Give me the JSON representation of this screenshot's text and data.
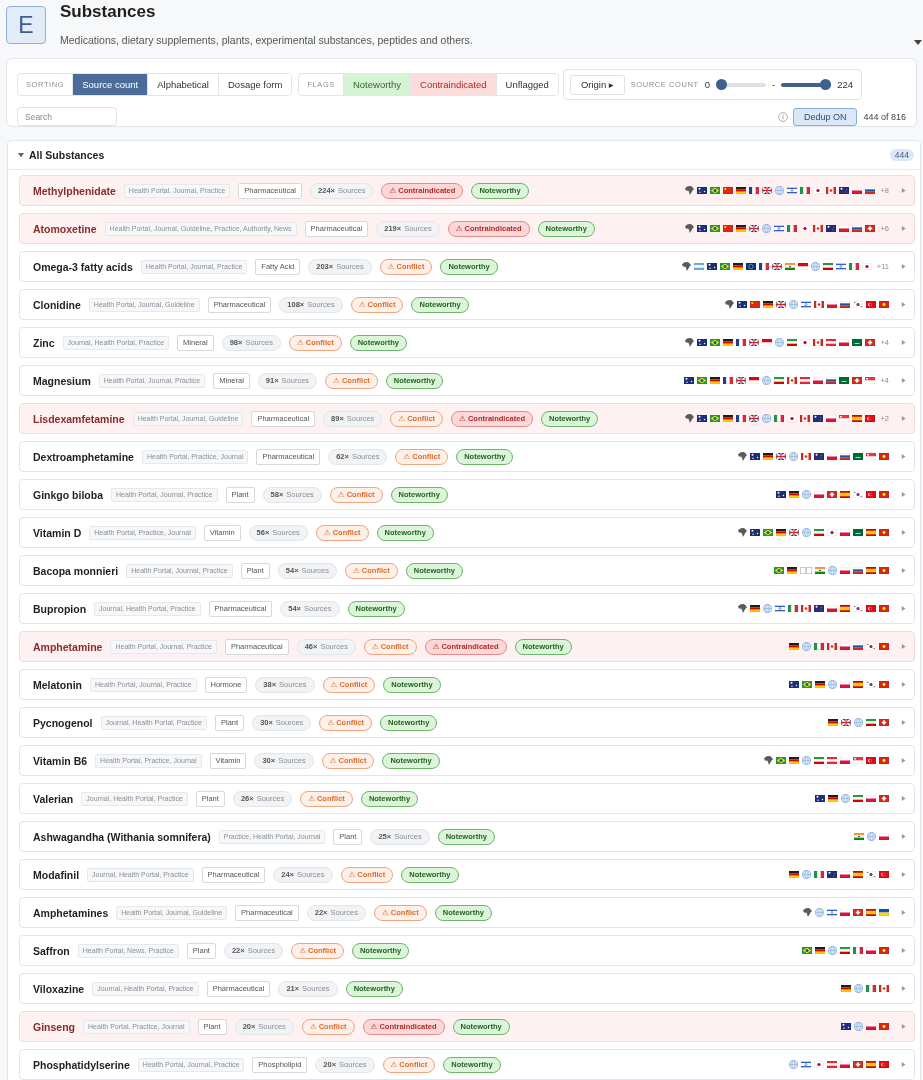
{
  "header": {
    "logo": "E",
    "title": "Substances",
    "subtitle": "Medications, dietary supplements, plants, experimental substances, peptides and others."
  },
  "toolbar": {
    "sorting": {
      "label": "SORTING",
      "options": [
        {
          "label": "Source count",
          "selected": true
        },
        {
          "label": "Alphabetical",
          "selected": false
        },
        {
          "label": "Dosage form",
          "selected": false
        }
      ]
    },
    "flags": {
      "label": "FLAGS",
      "options": [
        {
          "label": "Noteworthy",
          "kind": "noteworthy"
        },
        {
          "label": "Contraindicated",
          "kind": "contraindicated"
        },
        {
          "label": "Unflagged",
          "kind": "unflagged"
        }
      ]
    },
    "origin_button": "Origin ▸",
    "source_count": {
      "label": "SOURCE COUNT",
      "min_reading": "0",
      "min_slider": {
        "level": 0
      },
      "separator": "-",
      "max_slider": {
        "level": 1
      },
      "max_reading": "224"
    },
    "search": {
      "placeholder": "Search"
    },
    "dedup": {
      "label": "Dedup ON",
      "on": true
    },
    "result_count": "444 of 816"
  },
  "section": {
    "title": "All Substances",
    "expanded": true,
    "count": "444",
    "rows": [
      {
        "name": "Methylphenidate",
        "source_types": "Health Portal, Journal, Practice",
        "form": "Pharmaceutical",
        "sources": "**224×** Sources",
        "badges": [
          {
            "kind": "contraindicated",
            "label": "⚠ Contraindicated"
          },
          {
            "kind": "noteworthy",
            "label": "Noteworthy"
          }
        ],
        "origins": [
          {
            "kind": "africa"
          },
          {
            "kind": "au"
          },
          {
            "kind": "br"
          },
          {
            "kind": "cn"
          },
          {
            "kind": "de"
          },
          {
            "kind": "fr"
          },
          {
            "kind": "gb"
          },
          {
            "kind": "globe"
          },
          {
            "kind": "il"
          },
          {
            "kind": "it"
          },
          {
            "kind": "jp"
          },
          {
            "kind": "ca"
          },
          {
            "kind": "nz"
          },
          {
            "kind": "pl"
          },
          {
            "kind": "ru"
          }
        ],
        "more": "+8",
        "expanded": false
      },
      {
        "name": "Atomoxetine",
        "source_types": "Health Portal, Journal, Guideline, Practice, Authority, News",
        "form": "Pharmaceutical",
        "sources": "**219×** Sources",
        "badges": [
          {
            "kind": "contraindicated",
            "label": "⚠ Contraindicated"
          },
          {
            "kind": "noteworthy",
            "label": "Noteworthy"
          }
        ],
        "origins": [
          {
            "kind": "africa"
          },
          {
            "kind": "au"
          },
          {
            "kind": "br"
          },
          {
            "kind": "cn"
          },
          {
            "kind": "de"
          },
          {
            "kind": "gb"
          },
          {
            "kind": "globe"
          },
          {
            "kind": "il"
          },
          {
            "kind": "it"
          },
          {
            "kind": "jp"
          },
          {
            "kind": "ca"
          },
          {
            "kind": "nz"
          },
          {
            "kind": "pl"
          },
          {
            "kind": "ru"
          },
          {
            "kind": "ch"
          }
        ],
        "more": "+6",
        "expanded": false
      },
      {
        "name": "Omega-3 fatty acids",
        "source_types": "Health Portal, Journal, Practice",
        "form": "Fatty Acid",
        "sources": "**203×** Sources",
        "badges": [
          {
            "kind": "conflict",
            "label": "⚠ Conflict"
          },
          {
            "kind": "noteworthy",
            "label": "Noteworthy"
          }
        ],
        "origins": [
          {
            "kind": "africa"
          },
          {
            "kind": "ar"
          },
          {
            "kind": "au"
          },
          {
            "kind": "br"
          },
          {
            "kind": "de"
          },
          {
            "kind": "eu"
          },
          {
            "kind": "fr"
          },
          {
            "kind": "gb"
          },
          {
            "kind": "in"
          },
          {
            "kind": "id"
          },
          {
            "kind": "globe"
          },
          {
            "kind": "ir"
          },
          {
            "kind": "il"
          },
          {
            "kind": "it"
          },
          {
            "kind": "jp"
          }
        ],
        "more": "+11",
        "expanded": false
      },
      {
        "name": "Clonidine",
        "source_types": "Health Portal, Journal, Guideline",
        "form": "Pharmaceutical",
        "sources": "**108×** Sources",
        "badges": [
          {
            "kind": "conflict",
            "label": "⚠ Conflict"
          },
          {
            "kind": "noteworthy",
            "label": "Noteworthy"
          }
        ],
        "origins": [
          {
            "kind": "africa"
          },
          {
            "kind": "au"
          },
          {
            "kind": "cn"
          },
          {
            "kind": "de"
          },
          {
            "kind": "gb"
          },
          {
            "kind": "globe"
          },
          {
            "kind": "il"
          },
          {
            "kind": "ca"
          },
          {
            "kind": "pl"
          },
          {
            "kind": "ru"
          },
          {
            "kind": "kr"
          },
          {
            "kind": "tr"
          },
          {
            "kind": "vn"
          }
        ],
        "expanded": false
      },
      {
        "name": "Zinc",
        "source_types": "Journal, Health Portal, Practice",
        "form": "Mineral",
        "sources": "**98×** Sources",
        "badges": [
          {
            "kind": "conflict",
            "label": "⚠ Conflict"
          },
          {
            "kind": "noteworthy",
            "label": "Noteworthy"
          }
        ],
        "origins": [
          {
            "kind": "africa"
          },
          {
            "kind": "au"
          },
          {
            "kind": "br"
          },
          {
            "kind": "de"
          },
          {
            "kind": "fr"
          },
          {
            "kind": "gb"
          },
          {
            "kind": "id"
          },
          {
            "kind": "globe"
          },
          {
            "kind": "ir"
          },
          {
            "kind": "jp"
          },
          {
            "kind": "ca"
          },
          {
            "kind": "at"
          },
          {
            "kind": "pl"
          },
          {
            "kind": "sa"
          },
          {
            "kind": "ch"
          }
        ],
        "more": "+4",
        "expanded": false
      },
      {
        "name": "Magnesium",
        "source_types": "Health Portal, Journal, Practice",
        "form": "Mineral",
        "sources": "**91×** Sources",
        "badges": [
          {
            "kind": "conflict",
            "label": "⚠ Conflict"
          },
          {
            "kind": "noteworthy",
            "label": "Noteworthy"
          }
        ],
        "origins": [
          {
            "kind": "au"
          },
          {
            "kind": "br"
          },
          {
            "kind": "de"
          },
          {
            "kind": "fr"
          },
          {
            "kind": "gb"
          },
          {
            "kind": "id"
          },
          {
            "kind": "globe"
          },
          {
            "kind": "ir"
          },
          {
            "kind": "ca"
          },
          {
            "kind": "at"
          },
          {
            "kind": "pl"
          },
          {
            "kind": "ru"
          },
          {
            "kind": "sa"
          },
          {
            "kind": "ch"
          },
          {
            "kind": "sg"
          }
        ],
        "more": "+4",
        "expanded": false
      },
      {
        "name": "Lisdexamfetamine",
        "source_types": "Health Portal, Journal, Guideline",
        "form": "Pharmaceutical",
        "sources": "**89×** Sources",
        "badges": [
          {
            "kind": "conflict",
            "label": "⚠ Conflict"
          },
          {
            "kind": "contraindicated",
            "label": "⚠ Contraindicated"
          },
          {
            "kind": "noteworthy",
            "label": "Noteworthy"
          }
        ],
        "origins": [
          {
            "kind": "africa"
          },
          {
            "kind": "au"
          },
          {
            "kind": "br"
          },
          {
            "kind": "de"
          },
          {
            "kind": "fr"
          },
          {
            "kind": "gb"
          },
          {
            "kind": "globe"
          },
          {
            "kind": "it"
          },
          {
            "kind": "jp"
          },
          {
            "kind": "ca"
          },
          {
            "kind": "nz"
          },
          {
            "kind": "pl"
          },
          {
            "kind": "sg"
          },
          {
            "kind": "es"
          },
          {
            "kind": "tr"
          }
        ],
        "more": "+2",
        "expanded": false
      },
      {
        "name": "Dextroamphetamine",
        "source_types": "Health Portal, Practice, Journal",
        "form": "Pharmaceutical",
        "sources": "**62×** Sources",
        "badges": [
          {
            "kind": "conflict",
            "label": "⚠ Conflict"
          },
          {
            "kind": "noteworthy",
            "label": "Noteworthy"
          }
        ],
        "origins": [
          {
            "kind": "africa"
          },
          {
            "kind": "au"
          },
          {
            "kind": "de"
          },
          {
            "kind": "gb"
          },
          {
            "kind": "globe"
          },
          {
            "kind": "ca"
          },
          {
            "kind": "nz"
          },
          {
            "kind": "pl"
          },
          {
            "kind": "ru"
          },
          {
            "kind": "sa"
          },
          {
            "kind": "sg"
          },
          {
            "kind": "vn"
          }
        ],
        "expanded": false
      },
      {
        "name": "Ginkgo biloba",
        "source_types": "Health Portal, Journal, Practice",
        "form": "Plant",
        "sources": "**58×** Sources",
        "badges": [
          {
            "kind": "conflict",
            "label": "⚠ Conflict"
          },
          {
            "kind": "noteworthy",
            "label": "Noteworthy"
          }
        ],
        "origins": [
          {
            "kind": "au"
          },
          {
            "kind": "de"
          },
          {
            "kind": "globe"
          },
          {
            "kind": "pl"
          },
          {
            "kind": "ch"
          },
          {
            "kind": "es"
          },
          {
            "kind": "kr"
          },
          {
            "kind": "tr"
          },
          {
            "kind": "vn"
          }
        ],
        "expanded": false
      },
      {
        "name": "Vitamin D",
        "source_types": "Health Portal, Practice, Journal",
        "form": "Vitamin",
        "sources": "**56×** Sources",
        "badges": [
          {
            "kind": "conflict",
            "label": "⚠ Conflict"
          },
          {
            "kind": "noteworthy",
            "label": "Noteworthy"
          }
        ],
        "origins": [
          {
            "kind": "africa"
          },
          {
            "kind": "au"
          },
          {
            "kind": "br"
          },
          {
            "kind": "de"
          },
          {
            "kind": "gb"
          },
          {
            "kind": "globe"
          },
          {
            "kind": "ir"
          },
          {
            "kind": "jp"
          },
          {
            "kind": "pl"
          },
          {
            "kind": "sa"
          },
          {
            "kind": "es"
          },
          {
            "kind": "vn"
          }
        ],
        "expanded": false
      },
      {
        "name": "Bacopa monnieri",
        "source_types": "Health Portal, Journal, Practice",
        "form": "Plant",
        "sources": "**54×** Sources",
        "badges": [
          {
            "kind": "conflict",
            "label": "⚠ Conflict"
          },
          {
            "kind": "noteworthy",
            "label": "Noteworthy"
          }
        ],
        "origins": [
          {
            "kind": "br"
          },
          {
            "kind": "de"
          },
          {
            "kind": "unknown"
          },
          {
            "kind": "in"
          },
          {
            "kind": "globe"
          },
          {
            "kind": "pl"
          },
          {
            "kind": "ru"
          },
          {
            "kind": "es"
          },
          {
            "kind": "vn"
          }
        ],
        "expanded": false
      },
      {
        "name": "Bupropion",
        "source_types": "Journal, Health Portal, Practice",
        "form": "Pharmaceutical",
        "sources": "**54×** Sources",
        "badges": [
          {
            "kind": "noteworthy",
            "label": "Noteworthy"
          }
        ],
        "origins": [
          {
            "kind": "africa"
          },
          {
            "kind": "de"
          },
          {
            "kind": "globe"
          },
          {
            "kind": "il"
          },
          {
            "kind": "it"
          },
          {
            "kind": "ca"
          },
          {
            "kind": "nz"
          },
          {
            "kind": "pl"
          },
          {
            "kind": "es"
          },
          {
            "kind": "kr"
          },
          {
            "kind": "tr"
          },
          {
            "kind": "vn"
          }
        ],
        "expanded": false
      },
      {
        "name": "Amphetamine",
        "source_types": "Health Portal, Journal, Practice",
        "form": "Pharmaceutical",
        "sources": "**46×** Sources",
        "badges": [
          {
            "kind": "conflict",
            "label": "⚠ Conflict"
          },
          {
            "kind": "contraindicated",
            "label": "⚠ Contraindicated"
          },
          {
            "kind": "noteworthy",
            "label": "Noteworthy"
          }
        ],
        "origins": [
          {
            "kind": "de"
          },
          {
            "kind": "globe"
          },
          {
            "kind": "it"
          },
          {
            "kind": "ca"
          },
          {
            "kind": "pl"
          },
          {
            "kind": "ru"
          },
          {
            "kind": "kr"
          },
          {
            "kind": "vn"
          }
        ],
        "expanded": false
      },
      {
        "name": "Melatonin",
        "source_types": "Health Portal, Journal, Practice",
        "form": "Hormone",
        "sources": "**38×** Sources",
        "badges": [
          {
            "kind": "conflict",
            "label": "⚠ Conflict"
          },
          {
            "kind": "noteworthy",
            "label": "Noteworthy"
          }
        ],
        "origins": [
          {
            "kind": "au"
          },
          {
            "kind": "br"
          },
          {
            "kind": "de"
          },
          {
            "kind": "globe"
          },
          {
            "kind": "pl"
          },
          {
            "kind": "es"
          },
          {
            "kind": "kr"
          },
          {
            "kind": "vn"
          }
        ],
        "expanded": false
      },
      {
        "name": "Pycnogenol",
        "source_types": "Journal, Health Portal, Practice",
        "form": "Plant",
        "sources": "**30×** Sources",
        "badges": [
          {
            "kind": "conflict",
            "label": "⚠ Conflict"
          },
          {
            "kind": "noteworthy",
            "label": "Noteworthy"
          }
        ],
        "origins": [
          {
            "kind": "de"
          },
          {
            "kind": "gb"
          },
          {
            "kind": "globe"
          },
          {
            "kind": "ir"
          },
          {
            "kind": "ch"
          }
        ],
        "expanded": false
      },
      {
        "name": "Vitamin B6",
        "source_types": "Health Portal, Practice, Journal",
        "form": "Vitamin",
        "sources": "**30×** Sources",
        "badges": [
          {
            "kind": "conflict",
            "label": "⚠ Conflict"
          },
          {
            "kind": "noteworthy",
            "label": "Noteworthy"
          }
        ],
        "origins": [
          {
            "kind": "africa"
          },
          {
            "kind": "br"
          },
          {
            "kind": "de"
          },
          {
            "kind": "globe"
          },
          {
            "kind": "ir"
          },
          {
            "kind": "at"
          },
          {
            "kind": "pl"
          },
          {
            "kind": "sg"
          },
          {
            "kind": "tr"
          },
          {
            "kind": "vn"
          }
        ],
        "expanded": false
      },
      {
        "name": "Valerian",
        "source_types": "Journal, Health Portal, Practice",
        "form": "Plant",
        "sources": "**26×** Sources",
        "badges": [
          {
            "kind": "conflict",
            "label": "⚠ Conflict"
          },
          {
            "kind": "noteworthy",
            "label": "Noteworthy"
          }
        ],
        "origins": [
          {
            "kind": "au"
          },
          {
            "kind": "de"
          },
          {
            "kind": "globe"
          },
          {
            "kind": "ir"
          },
          {
            "kind": "pl"
          },
          {
            "kind": "ch"
          }
        ],
        "expanded": false
      },
      {
        "name": "Ashwagandha (Withania somnifera)",
        "source_types": "Practice, Health Portal, Journal",
        "form": "Plant",
        "sources": "**25×** Sources",
        "badges": [
          {
            "kind": "noteworthy",
            "label": "Noteworthy"
          }
        ],
        "origins": [
          {
            "kind": "in"
          },
          {
            "kind": "globe"
          },
          {
            "kind": "pl"
          }
        ],
        "expanded": false
      },
      {
        "name": "Modafinil",
        "source_types": "Journal, Health Portal, Practice",
        "form": "Pharmaceutical",
        "sources": "**24×** Sources",
        "badges": [
          {
            "kind": "conflict",
            "label": "⚠ Conflict"
          },
          {
            "kind": "noteworthy",
            "label": "Noteworthy"
          }
        ],
        "origins": [
          {
            "kind": "de"
          },
          {
            "kind": "globe"
          },
          {
            "kind": "it"
          },
          {
            "kind": "nz"
          },
          {
            "kind": "pl"
          },
          {
            "kind": "es"
          },
          {
            "kind": "kr"
          },
          {
            "kind": "tr"
          }
        ],
        "expanded": false
      },
      {
        "name": "Amphetamines",
        "source_types": "Health Portal, Journal, Guideline",
        "form": "Pharmaceutical",
        "sources": "**22×** Sources",
        "badges": [
          {
            "kind": "conflict",
            "label": "⚠ Conflict"
          },
          {
            "kind": "noteworthy",
            "label": "Noteworthy"
          }
        ],
        "origins": [
          {
            "kind": "africa"
          },
          {
            "kind": "globe"
          },
          {
            "kind": "il"
          },
          {
            "kind": "pl"
          },
          {
            "kind": "ch"
          },
          {
            "kind": "es"
          },
          {
            "kind": "ua"
          }
        ],
        "expanded": false
      },
      {
        "name": "Saffron",
        "source_types": "Health Portal, News, Practice",
        "form": "Plant",
        "sources": "**22×** Sources",
        "badges": [
          {
            "kind": "conflict",
            "label": "⚠ Conflict"
          },
          {
            "kind": "noteworthy",
            "label": "Noteworthy"
          }
        ],
        "origins": [
          {
            "kind": "br"
          },
          {
            "kind": "de"
          },
          {
            "kind": "globe"
          },
          {
            "kind": "ir"
          },
          {
            "kind": "it"
          },
          {
            "kind": "pl"
          },
          {
            "kind": "vn"
          }
        ],
        "expanded": false
      },
      {
        "name": "Viloxazine",
        "source_types": "Journal, Health Portal, Practice",
        "form": "Pharmaceutical",
        "sources": "**21×** Sources",
        "badges": [
          {
            "kind": "noteworthy",
            "label": "Noteworthy"
          }
        ],
        "origins": [
          {
            "kind": "de"
          },
          {
            "kind": "globe"
          },
          {
            "kind": "it"
          },
          {
            "kind": "ca"
          }
        ],
        "expanded": false
      },
      {
        "name": "Ginseng",
        "source_types": "Health Portal, Practice, Journal",
        "form": "Plant",
        "sources": "**20×** Sources",
        "badges": [
          {
            "kind": "conflict",
            "label": "⚠ Conflict"
          },
          {
            "kind": "contraindicated",
            "label": "⚠ Contraindicated"
          },
          {
            "kind": "noteworthy",
            "label": "Noteworthy"
          }
        ],
        "origins": [
          {
            "kind": "au"
          },
          {
            "kind": "globe"
          },
          {
            "kind": "pl"
          },
          {
            "kind": "vn"
          }
        ],
        "expanded": false
      },
      {
        "name": "Phosphatidylserine",
        "source_types": "Health Portal, Journal, Practice",
        "form": "Phospholipid",
        "sources": "**20×** Sources",
        "badges": [
          {
            "kind": "conflict",
            "label": "⚠ Conflict"
          },
          {
            "kind": "noteworthy",
            "label": "Noteworthy"
          }
        ],
        "origins": [
          {
            "kind": "globe"
          },
          {
            "kind": "il"
          },
          {
            "kind": "jp"
          },
          {
            "kind": "at"
          },
          {
            "kind": "pl"
          },
          {
            "kind": "ch"
          },
          {
            "kind": "es"
          },
          {
            "kind": "tr"
          }
        ],
        "expanded": false
      }
    ]
  }
}
